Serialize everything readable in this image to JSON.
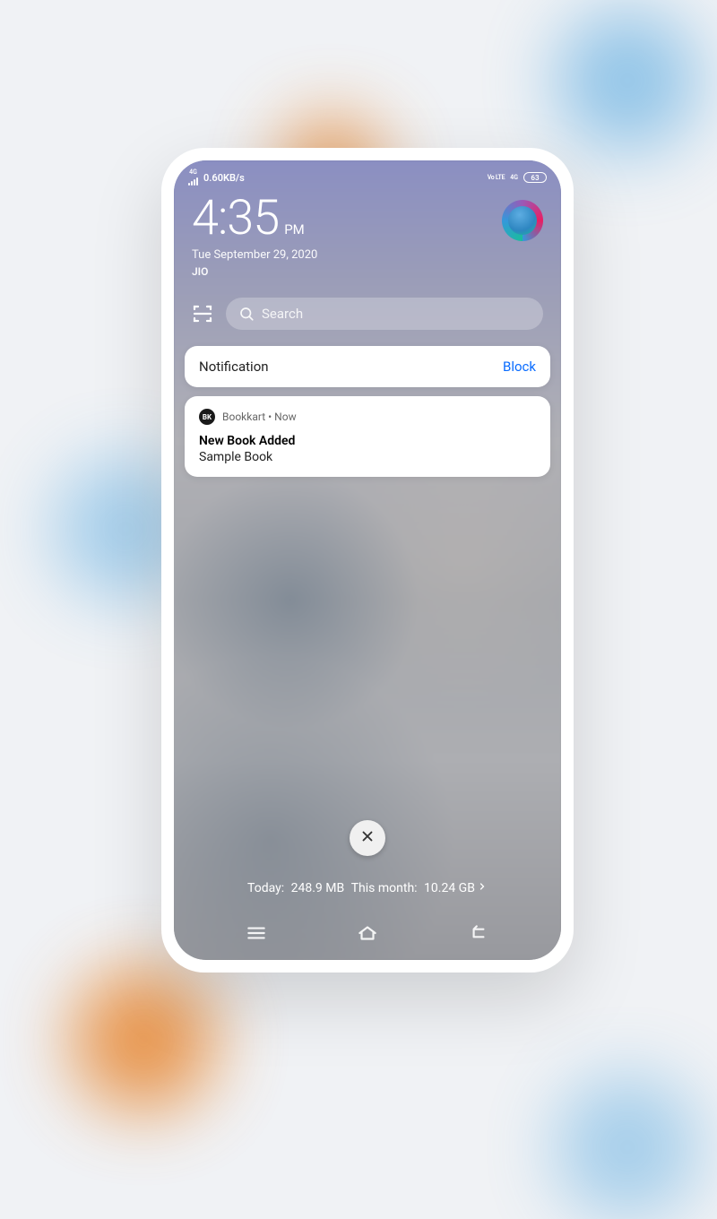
{
  "status": {
    "network_type": "4G",
    "data_speed": "0.60KB/s",
    "volte": "Vo LTE",
    "net_right": "4G",
    "battery": "63"
  },
  "clock": {
    "time": "4:35",
    "ampm": "PM",
    "date": "Tue September 29, 2020",
    "carrier": "JIO"
  },
  "search": {
    "placeholder": "Search"
  },
  "notification_header": {
    "title": "Notification",
    "action": "Block"
  },
  "notification": {
    "app": "Bookkart",
    "separator": "•",
    "time": "Now",
    "title": "New Book Added",
    "body": "Sample Book",
    "icon_text": "BK"
  },
  "data_usage": {
    "today_label": "Today:",
    "today_value": "248.9 MB",
    "month_label": "This month:",
    "month_value": "10.24 GB"
  }
}
